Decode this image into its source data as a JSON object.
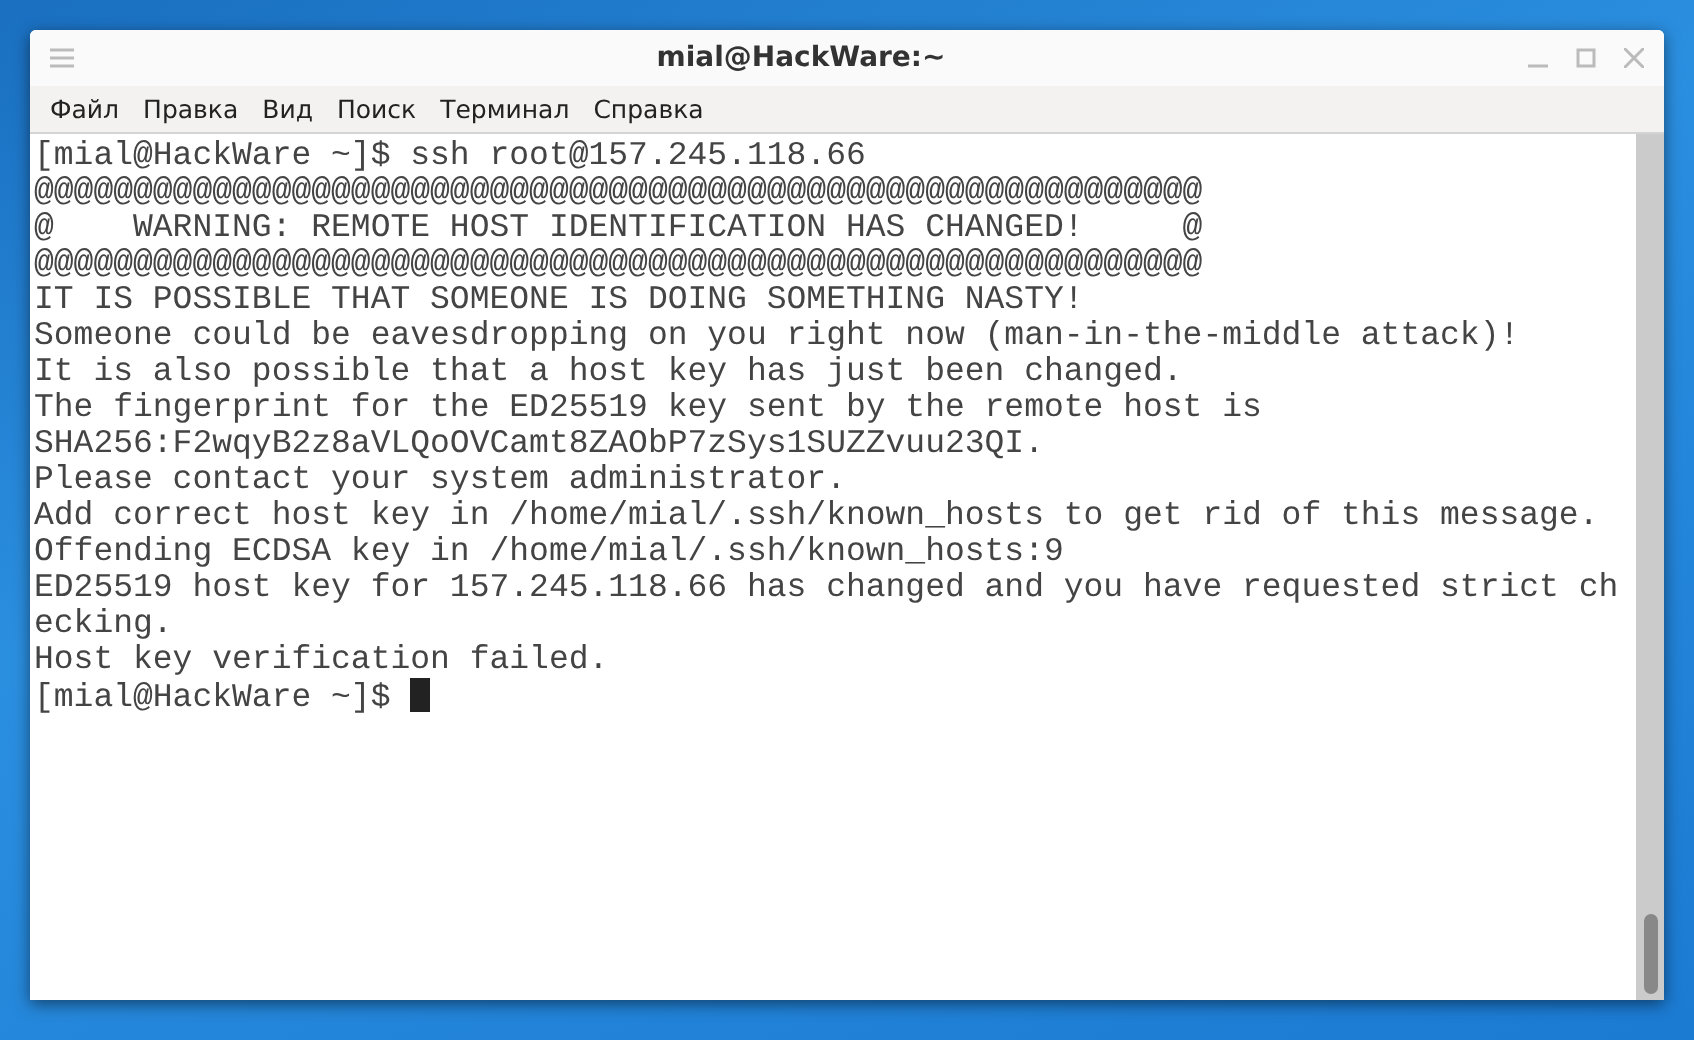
{
  "window": {
    "title": "mial@HackWare:~"
  },
  "menu": [
    "Файл",
    "Правка",
    "Вид",
    "Поиск",
    "Терминал",
    "Справка"
  ],
  "terminal": {
    "lines": [
      "[mial@HackWare ~]$ ssh root@157.245.118.66",
      "@@@@@@@@@@@@@@@@@@@@@@@@@@@@@@@@@@@@@@@@@@@@@@@@@@@@@@@@@@@",
      "@    WARNING: REMOTE HOST IDENTIFICATION HAS CHANGED!     @",
      "@@@@@@@@@@@@@@@@@@@@@@@@@@@@@@@@@@@@@@@@@@@@@@@@@@@@@@@@@@@",
      "IT IS POSSIBLE THAT SOMEONE IS DOING SOMETHING NASTY!",
      "Someone could be eavesdropping on you right now (man-in-the-middle attack)!",
      "It is also possible that a host key has just been changed.",
      "The fingerprint for the ED25519 key sent by the remote host is",
      "SHA256:F2wqyB2z8aVLQoOVCamt8ZAObP7zSys1SUZZvuu23QI.",
      "Please contact your system administrator.",
      "Add correct host key in /home/mial/.ssh/known_hosts to get rid of this message.",
      "Offending ECDSA key in /home/mial/.ssh/known_hosts:9",
      "ED25519 host key for 157.245.118.66 has changed and you have requested strict ch",
      "ecking.",
      "Host key verification failed."
    ],
    "prompt": "[mial@HackWare ~]$ "
  }
}
